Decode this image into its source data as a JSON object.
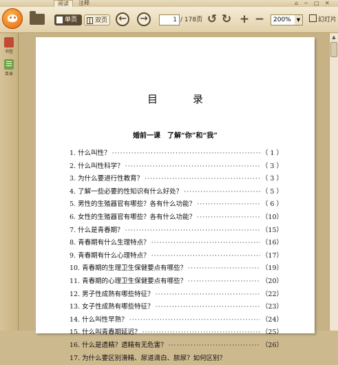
{
  "tabs": [
    {
      "label": "阅读"
    },
    {
      "label": "注释"
    }
  ],
  "window_controls": [
    "⌂",
    "─",
    "□",
    "✕"
  ],
  "toolbar": {
    "single_page": "单页",
    "double_page": "双页",
    "current_page": "1",
    "total_pages": "/ 178页",
    "zoom": "200%",
    "slideshow": "幻灯片"
  },
  "sidebar": {
    "bookmarks": "书签",
    "toc": "目录"
  },
  "page": {
    "title": "目　录",
    "section": "婚前一课　了解“你”和“我”",
    "entries": [
      {
        "text": "1. 什么叫性？",
        "page": "（ 1 ）"
      },
      {
        "text": "2. 什么叫性科学？",
        "page": "（ 3 ）"
      },
      {
        "text": "3. 为什么要进行性教育？",
        "page": "（ 3 ）"
      },
      {
        "text": "4. 了解一些必要的性知识有什么好处？",
        "page": "（ 5 ）"
      },
      {
        "text": "5. 男性的生殖器官有哪些？各有什么功能？",
        "page": "（ 6 ）"
      },
      {
        "text": "6. 女性的生殖器官有哪些？各有什么功能？",
        "page": "（10）"
      },
      {
        "text": "7. 什么是青春期？",
        "page": "（15）"
      },
      {
        "text": "8. 青春期有什么生理特点？",
        "page": "（16）"
      },
      {
        "text": "9. 青春期有什么心理特点？",
        "page": "（17）"
      },
      {
        "text": "10. 青春期的生理卫生保健要点有哪些？",
        "page": "（19）"
      },
      {
        "text": "11. 青春期的心理卫生保健要点有哪些？",
        "page": "（20）"
      },
      {
        "text": "12. 男子性成熟有哪些特征？",
        "page": "（22）"
      },
      {
        "text": "13. 女子性成熟有哪些特征？",
        "page": "（23）"
      },
      {
        "text": "14. 什么叫性早熟？",
        "page": "（24）"
      },
      {
        "text": "15. 什么叫青春期延迟？",
        "page": "（25）"
      },
      {
        "text": "16. 什么是遗精？遗精有无危害？",
        "page": "（26）"
      },
      {
        "text": "17. 为什么要区别滑精、尿道滴白、脓尿？如何区别？",
        "page": ""
      }
    ]
  }
}
